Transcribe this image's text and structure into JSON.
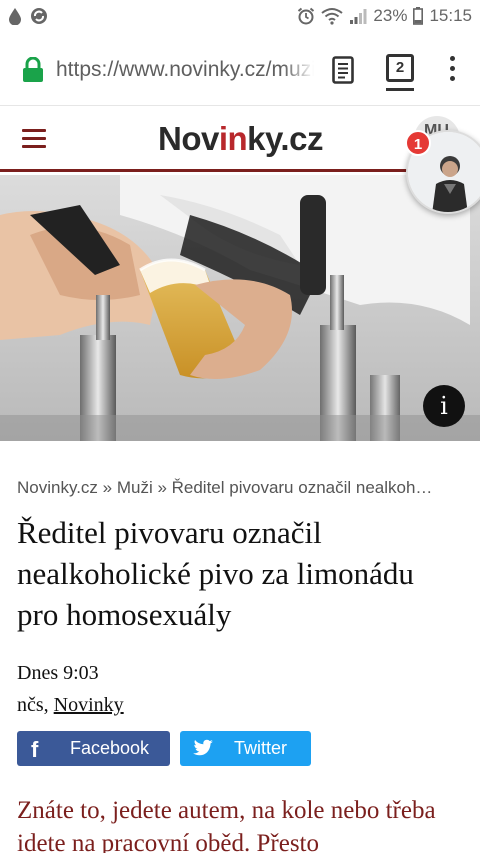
{
  "status_bar": {
    "battery": "23%",
    "time": "15:15"
  },
  "browser": {
    "url": "https://www.novinky.cz/muzi",
    "tab_count": "2"
  },
  "site": {
    "logo_part1": "Nov",
    "logo_accent": "in",
    "logo_part2": "ky.cz",
    "profile_peek": "MU"
  },
  "chat_head": {
    "badge": "1"
  },
  "hero": {
    "info_label": "i"
  },
  "article": {
    "breadcrumb": "Novinky.cz » Muži » Ředitel pivovaru označil nealkoh…",
    "title": "Ředitel pivovaru označil nealkoholické pivo za limonádu pro homosexuály",
    "date": "Dnes 9:03",
    "author_prefix": "nčs, ",
    "author_link": "Novinky",
    "lead": "Znáte to, jedete autem, na kole nebo třeba idete na pracovní oběd. Přesto"
  },
  "share": {
    "facebook_label": "Facebook",
    "twitter_label": "Twitter"
  },
  "colors": {
    "accent": "#7b1f1d",
    "logo_accent": "#b8282c",
    "facebook": "#3b5998",
    "twitter": "#1da1f2",
    "badge": "#e53935"
  }
}
